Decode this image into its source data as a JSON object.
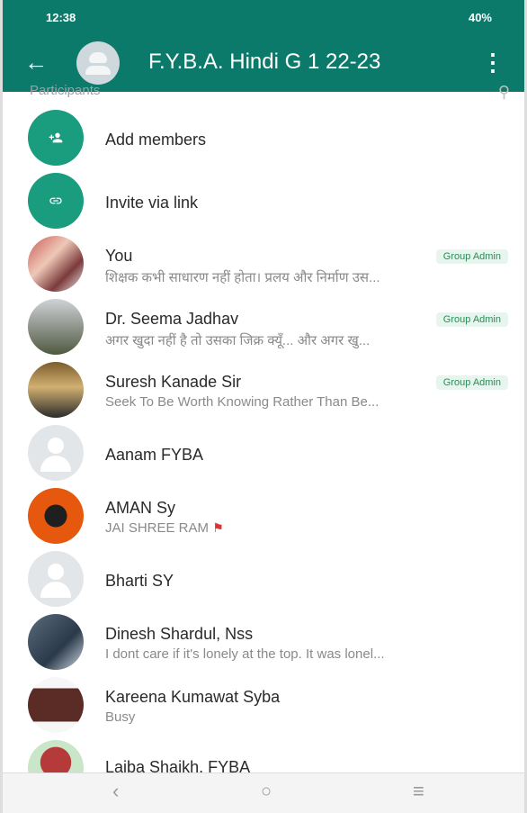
{
  "status_bar": {
    "time": "12:38",
    "right": "40%"
  },
  "app_bar": {
    "title": "F.Y.B.A. Hindi G 1 22-23"
  },
  "top_hint": "Participants",
  "actions": [
    {
      "label": "Add members",
      "icon": "add-member-icon"
    },
    {
      "label": "Invite via link",
      "icon": "link-icon"
    }
  ],
  "members": [
    {
      "name": "You",
      "subtitle": "शिक्षक कभी साधारण नहीं होता। प्रलय और निर्माण उस...",
      "badge": "Group Admin"
    },
    {
      "name": "Dr. Seema Jadhav",
      "subtitle": "अगर खुदा नहीं है तो उसका जिक्र क्यूँ... और अगर खु...",
      "badge": "Group Admin"
    },
    {
      "name": "Suresh Kanade Sir",
      "subtitle": "Seek To Be Worth Knowing Rather Than Be...",
      "badge": "Group Admin"
    },
    {
      "name": "Aanam FYBA",
      "subtitle": ""
    },
    {
      "name": "AMAN Sy",
      "subtitle": "JAI SHREE RAM"
    },
    {
      "name": "Bharti SY",
      "subtitle": ""
    },
    {
      "name": "Dinesh Shardul, Nss",
      "subtitle": "I dont care if it's lonely at the top. It was lonel..."
    },
    {
      "name": "Kareena Kumawat Syba",
      "subtitle": "Busy"
    },
    {
      "name": "Laiba Shaikh, FYBA",
      "subtitle": ""
    }
  ],
  "icons": {
    "back": "back-arrow-icon",
    "menu": "more-vert-icon",
    "search": "search-icon"
  }
}
